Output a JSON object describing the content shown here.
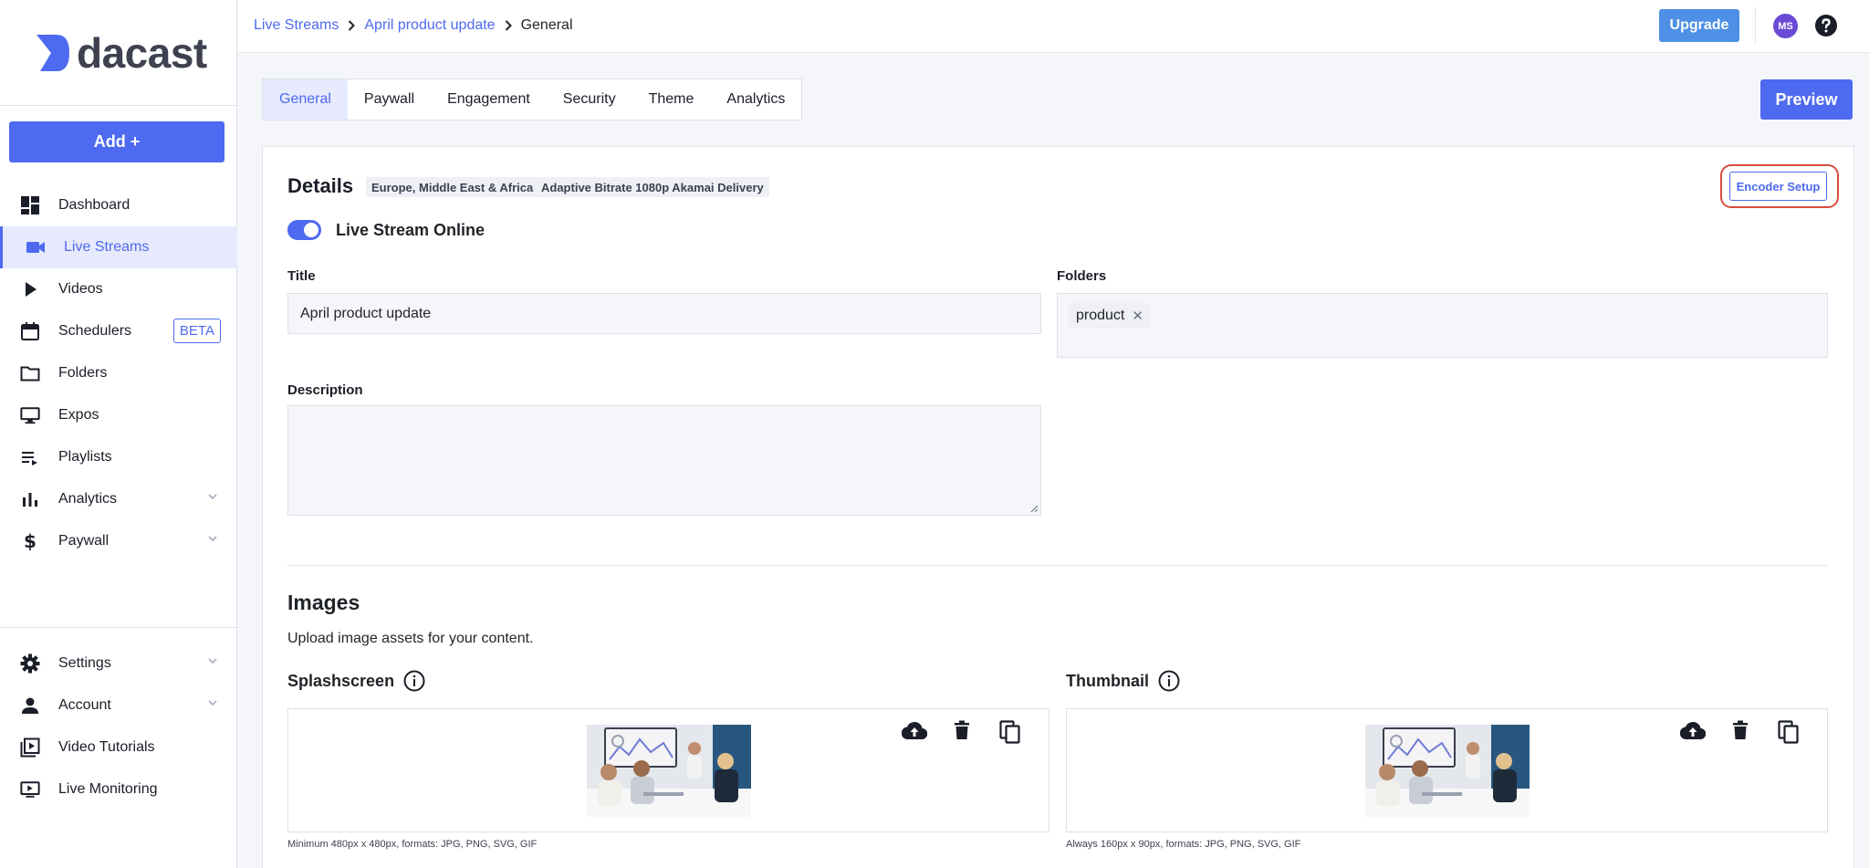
{
  "brand": {
    "name": "dacast"
  },
  "sidebar": {
    "add_label": "Add +",
    "items": [
      {
        "label": "Dashboard",
        "icon": "dashboard-icon"
      },
      {
        "label": "Live Streams",
        "icon": "video-camera-icon",
        "active": true
      },
      {
        "label": "Videos",
        "icon": "play-icon"
      },
      {
        "label": "Schedulers",
        "icon": "calendar-icon",
        "badge": "BETA"
      },
      {
        "label": "Folders",
        "icon": "folder-icon"
      },
      {
        "label": "Expos",
        "icon": "monitor-icon"
      },
      {
        "label": "Playlists",
        "icon": "playlist-icon"
      },
      {
        "label": "Analytics",
        "icon": "bar-chart-icon",
        "expandable": true
      },
      {
        "label": "Paywall",
        "icon": "dollar-icon",
        "expandable": true
      }
    ],
    "bottom_items": [
      {
        "label": "Settings",
        "icon": "gear-icon",
        "expandable": true
      },
      {
        "label": "Account",
        "icon": "person-icon",
        "expandable": true
      },
      {
        "label": "Video Tutorials",
        "icon": "video-library-icon"
      },
      {
        "label": "Live Monitoring",
        "icon": "live-monitor-icon"
      }
    ]
  },
  "header": {
    "breadcrumb": [
      "Live Streams",
      "April product update",
      "General"
    ],
    "upgrade_label": "Upgrade",
    "avatar_initials": "MS"
  },
  "tabs": [
    "General",
    "Paywall",
    "Engagement",
    "Security",
    "Theme",
    "Analytics"
  ],
  "active_tab": "General",
  "preview_label": "Preview",
  "details": {
    "heading": "Details",
    "chips": [
      "Europe, Middle East & Africa",
      "Adaptive Bitrate 1080p Akamai Delivery"
    ],
    "encoder_label": "Encoder Setup",
    "online_label": "Live Stream Online",
    "online": true,
    "title_label": "Title",
    "title_value": "April product update",
    "folders_label": "Folders",
    "folders": [
      "product"
    ],
    "description_label": "Description",
    "description_value": ""
  },
  "images": {
    "heading": "Images",
    "subtitle": "Upload image assets for your content.",
    "splash": {
      "label": "Splashscreen",
      "hint": "Minimum 480px x 480px, formats: JPG, PNG, SVG, GIF"
    },
    "thumbnail": {
      "label": "Thumbnail",
      "hint": "Always 160px x 90px, formats: JPG, PNG, SVG, GIF"
    }
  },
  "colors": {
    "accent": "#4e6af0",
    "upgrade": "#4d90e5",
    "highlight_ring": "#d94c3d",
    "avatar": "#6a4ad4"
  }
}
